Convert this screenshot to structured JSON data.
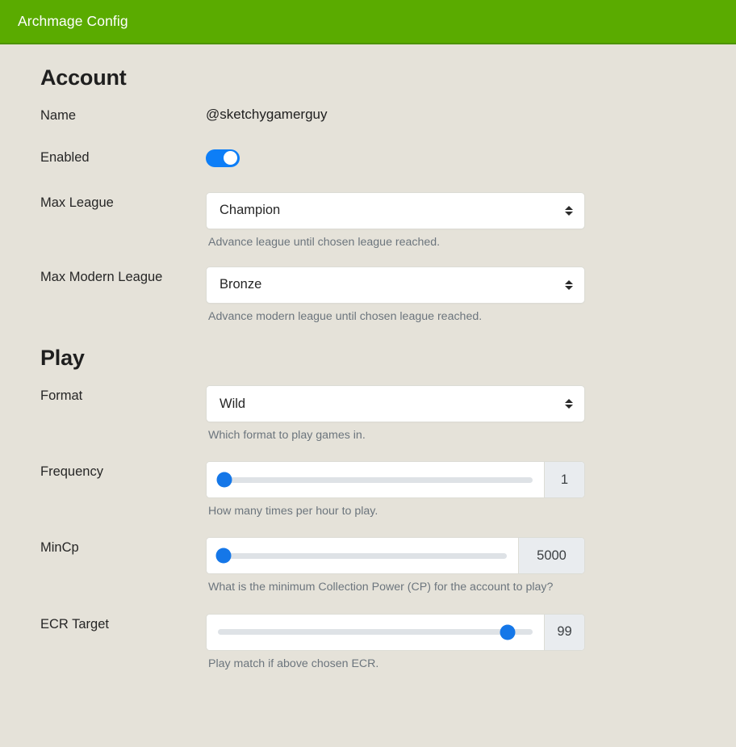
{
  "header": {
    "title": "Archmage Config",
    "background_color": "#5aab00"
  },
  "page": {
    "background_color": "#e5e2d9"
  },
  "sections": {
    "account": {
      "title": "Account",
      "name": {
        "label": "Name",
        "value": "@sketchygamerguy"
      },
      "enabled": {
        "label": "Enabled",
        "value": "on",
        "accent_color": "#0d7ef7"
      },
      "max_league": {
        "label": "Max League",
        "value": "Champion",
        "help": "Advance league until chosen league reached."
      },
      "max_modern_league": {
        "label": "Max Modern League",
        "value": "Bronze",
        "help": "Advance modern league until chosen league reached."
      }
    },
    "play": {
      "title": "Play",
      "format": {
        "label": "Format",
        "value": "Wild",
        "help": "Which format to play games in."
      },
      "frequency": {
        "label": "Frequency",
        "value": "1",
        "percent": 2,
        "help": "How many times per hour to play."
      },
      "mincp": {
        "label": "MinCp",
        "value": "5000",
        "percent": 2,
        "help": "What is the minimum Collection Power (CP) for the account to play?"
      },
      "ecr_target": {
        "label": "ECR Target",
        "value": "99",
        "percent": 92,
        "help": "Play match if above chosen ECR."
      }
    }
  }
}
